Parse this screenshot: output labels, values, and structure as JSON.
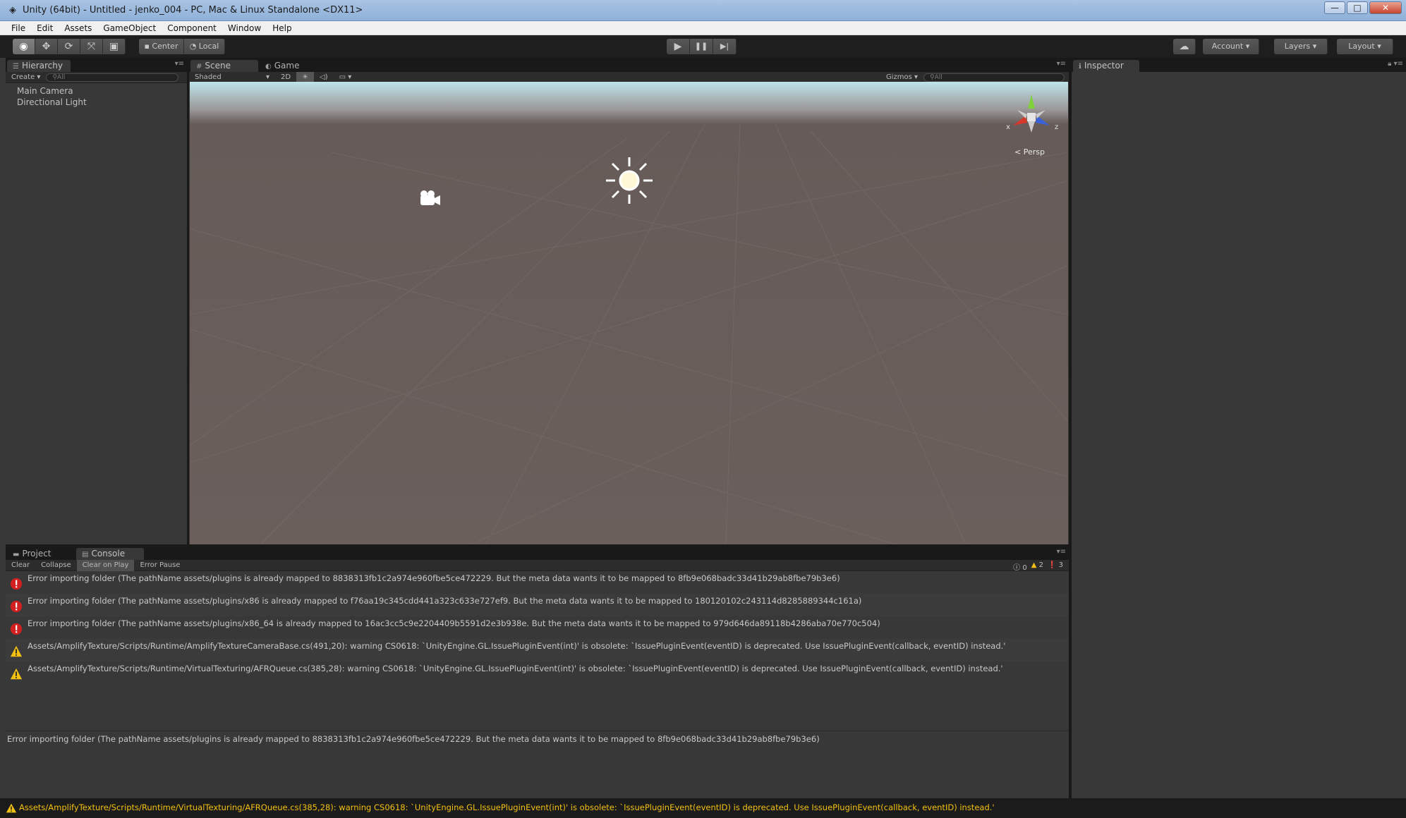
{
  "window": {
    "title": "Unity (64bit) - Untitled - jenko_004 - PC, Mac & Linux Standalone <DX11>",
    "icon": "unity-logo-icon",
    "buttons": {
      "minimize": "—",
      "maximize": "□",
      "close": "✕"
    }
  },
  "menu": {
    "items": [
      "File",
      "Edit",
      "Assets",
      "GameObject",
      "Component",
      "Window",
      "Help"
    ]
  },
  "toolbar": {
    "tools": [
      "hand-icon",
      "move-icon",
      "rotate-icon",
      "scale-icon",
      "rect-icon"
    ],
    "pivot": "Center",
    "space": "Local",
    "play": "▶",
    "pause": "❚❚",
    "step": "▶|",
    "cloud_icon": "cloud-icon",
    "account": "Account",
    "layers": "Layers",
    "layout": "Layout"
  },
  "hierarchy": {
    "tab": "Hierarchy",
    "create": "Create",
    "search_placeholder": "All",
    "items": [
      "Main Camera",
      "Directional Light"
    ]
  },
  "scene": {
    "tabs": [
      "Scene",
      "Game"
    ],
    "shading": "Shaded",
    "mode_2d": "2D",
    "gizmos": "Gizmos",
    "search_placeholder": "All",
    "projection": "Persp",
    "axis_labels": {
      "x": "x",
      "z": "z"
    }
  },
  "inspector": {
    "tab": "Inspector"
  },
  "console": {
    "tabs": [
      "Project",
      "Console"
    ],
    "buttons": [
      "Clear",
      "Collapse",
      "Clear on Play",
      "Error Pause"
    ],
    "counts": {
      "info": "0",
      "warnings": "2",
      "errors": "3"
    },
    "entries": [
      {
        "type": "error",
        "text": "Error importing folder (The pathName assets/plugins is already mapped to 8838313fb1c2a974e960fbe5ce472229. But the meta data wants it to be mapped to 8fb9e068badc33d41b29ab8fbe79b3e6)"
      },
      {
        "type": "error",
        "text": "Error importing folder (The pathName assets/plugins/x86 is already mapped to f76aa19c345cdd441a323c633e727ef9. But the meta data wants it to be mapped to 180120102c243114d8285889344c161a)"
      },
      {
        "type": "error",
        "text": "Error importing folder (The pathName assets/plugins/x86_64 is already mapped to 16ac3cc5c9e2204409b5591d2e3b938e. But the meta data wants it to be mapped to 979d646da89118b4286aba70e770c504)"
      },
      {
        "type": "warning",
        "text": "Assets/AmplifyTexture/Scripts/Runtime/AmplifyTextureCameraBase.cs(491,20): warning CS0618: `UnityEngine.GL.IssuePluginEvent(int)' is obsolete: `IssuePluginEvent(eventID) is deprecated. Use IssuePluginEvent(callback, eventID) instead.'"
      },
      {
        "type": "warning",
        "text": "Assets/AmplifyTexture/Scripts/Runtime/VirtualTexturing/AFRQueue.cs(385,28): warning CS0618: `UnityEngine.GL.IssuePluginEvent(int)' is obsolete: `IssuePluginEvent(eventID) is deprecated. Use IssuePluginEvent(callback, eventID) instead.'"
      }
    ],
    "detail": "Error importing folder (The pathName assets/plugins is already mapped to 8838313fb1c2a974e960fbe5ce472229. But the meta data wants it to be mapped to 8fb9e068badc33d41b29ab8fbe79b3e6)"
  },
  "status": {
    "text": "Assets/AmplifyTexture/Scripts/Runtime/VirtualTexturing/AFRQueue.cs(385,28): warning CS0618: `UnityEngine.GL.IssuePluginEvent(int)' is obsolete: `IssuePluginEvent(eventID) is deprecated. Use IssuePluginEvent(callback, eventID) instead.'"
  },
  "colors": {
    "error": "#d21f1f",
    "warning": "#f2c011",
    "status_text": "#f2c011",
    "gizmo_x": "#d33a2c",
    "gizmo_y": "#7fd03a",
    "gizmo_z": "#3a62d8"
  }
}
